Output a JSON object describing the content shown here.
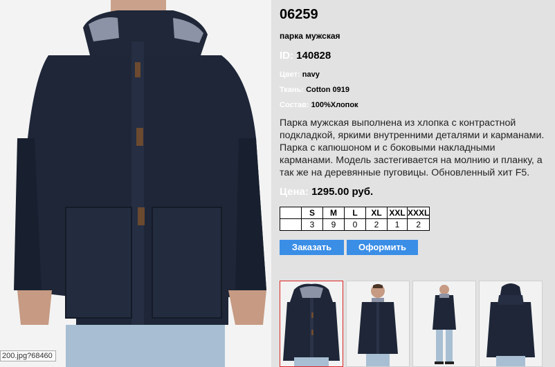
{
  "product": {
    "article": "06259",
    "subtitle": "парка мужская",
    "id_label": "ID:",
    "id_value": "140828",
    "color_label": "Цвет:",
    "color_value": "navy",
    "fabric_label": "Ткань:",
    "fabric_value": "Cotton 0919",
    "composition_label": "Состав:",
    "composition_value": "100%Хлопок",
    "description": "Парка мужская выполнена из хлопка с контрастной подкладкой, яркими внутренними деталями и карманами. Парка с капюшоном и с боковыми накладными карманами. Модель застегивается на молнию и планку, а так же на деревянные пуговицы. Обновленный хит F5.",
    "price_label": "Цена:",
    "price_value": "1295.00 руб."
  },
  "sizes": {
    "headers": [
      "S",
      "M",
      "L",
      "XL",
      "XXL",
      "XXXL"
    ],
    "quantities": [
      "3",
      "9",
      "0",
      "2",
      "1",
      "2"
    ]
  },
  "buttons": {
    "order": "Заказать",
    "checkout": "Оформить"
  },
  "tooltip": "200.jpg?68460",
  "colors": {
    "background": "#e2e2e2",
    "label_white": "#ffffff",
    "button_blue": "#3a8ee6",
    "selected_border": "#dd2222",
    "jacket_navy": "#1e2638"
  },
  "thumbnails": [
    {
      "name": "thumb-front-closeup",
      "selected": true
    },
    {
      "name": "thumb-front-model",
      "selected": false
    },
    {
      "name": "thumb-full-length",
      "selected": false
    },
    {
      "name": "thumb-back-view",
      "selected": false
    }
  ]
}
